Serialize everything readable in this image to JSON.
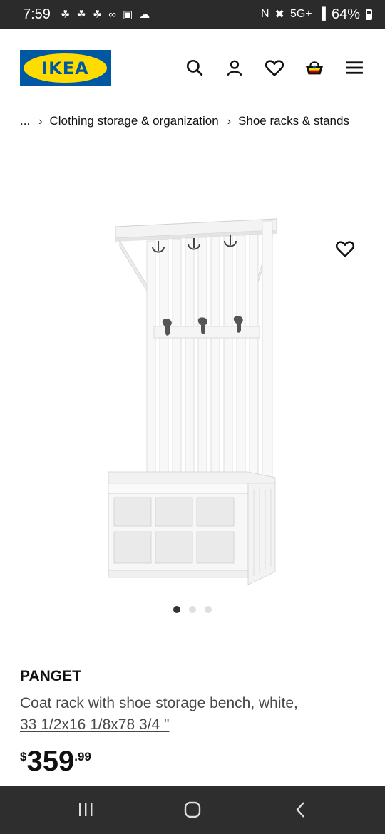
{
  "status_bar": {
    "time": "7:59",
    "left_icons": [
      "notification-icon",
      "notification-icon",
      "notification-icon",
      "voicemail-icon",
      "gallery-icon",
      "cloud-icon"
    ],
    "network": "5G+",
    "battery": "64%"
  },
  "header": {
    "logo_text": "IKEA",
    "icons": [
      "search-icon",
      "profile-icon",
      "heart-icon",
      "basket-icon",
      "menu-icon"
    ]
  },
  "breadcrumb": {
    "ellipsis": "...",
    "items": [
      "Clothing storage & organization",
      "Shoe racks & stands"
    ]
  },
  "carousel": {
    "total_slides": 3,
    "active_slide": 1
  },
  "product": {
    "name": "PANGET",
    "description": "Coat rack with shoe storage bench, white,",
    "size": "33 1/2x16 1/8x78 3/4 \"",
    "price": {
      "currency": "$",
      "integer": "359",
      "decimal": ".99"
    }
  },
  "colors": {
    "brand_blue": "#0058a3",
    "brand_yellow": "#ffdb00",
    "status_bar_bg": "#2b2b2b",
    "nav_bar_bg": "#2e2e2e"
  }
}
